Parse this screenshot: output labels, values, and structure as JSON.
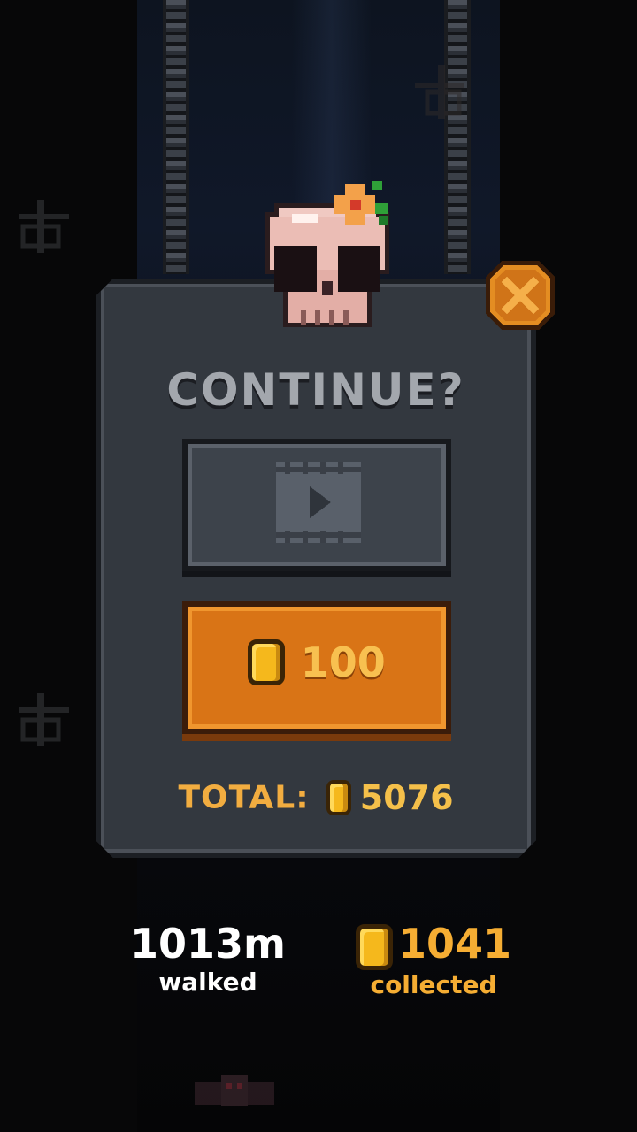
{
  "dialog": {
    "title": "CONTINUE?",
    "coin_price": "100",
    "total_label": "TOTAL:",
    "total_coins": "5076"
  },
  "stats": {
    "distance_value": "1013m",
    "distance_label": "walked",
    "coins_value": "1041",
    "coins_label": "collected"
  },
  "colors": {
    "panel": "#33383f",
    "accent_orange": "#d97416",
    "coin_gold": "#f5b81c",
    "gold_text": "#f5ad33"
  },
  "icons": {
    "close": "close-icon",
    "video": "video-play-icon",
    "coin": "coin-icon",
    "skull": "skull-icon"
  }
}
